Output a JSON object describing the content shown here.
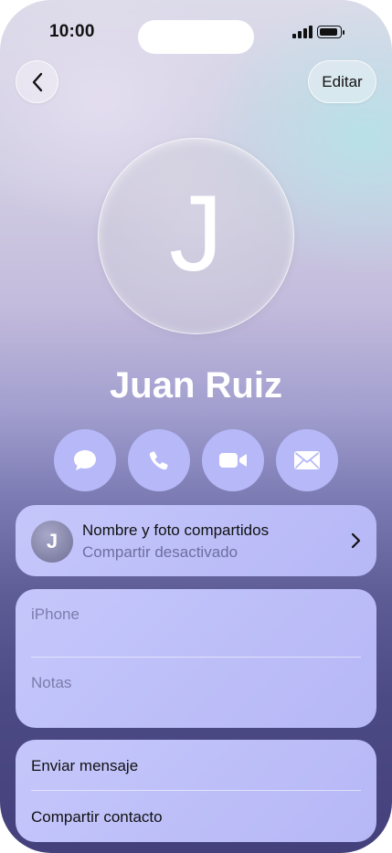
{
  "status_bar": {
    "time": "10:00"
  },
  "nav": {
    "edit_label": "Editar"
  },
  "contact": {
    "initial": "J",
    "name": "Juan Ruiz"
  },
  "actions": [
    {
      "icon": "message-icon"
    },
    {
      "icon": "phone-icon"
    },
    {
      "icon": "video-icon"
    },
    {
      "icon": "mail-icon"
    }
  ],
  "sharing": {
    "initial": "J",
    "title": "Nombre y foto compartidos",
    "subtitle": "Compartir desactivado"
  },
  "info": {
    "phone_label": "iPhone",
    "notes_label": "Notas"
  },
  "bottom_actions": {
    "send_message": "Enviar mensaje",
    "share_contact": "Compartir contacto"
  },
  "colors": {
    "action_bg": "#b6b8f8",
    "card_bg": "#c0c2fa",
    "icon_color": "#ffffff"
  }
}
